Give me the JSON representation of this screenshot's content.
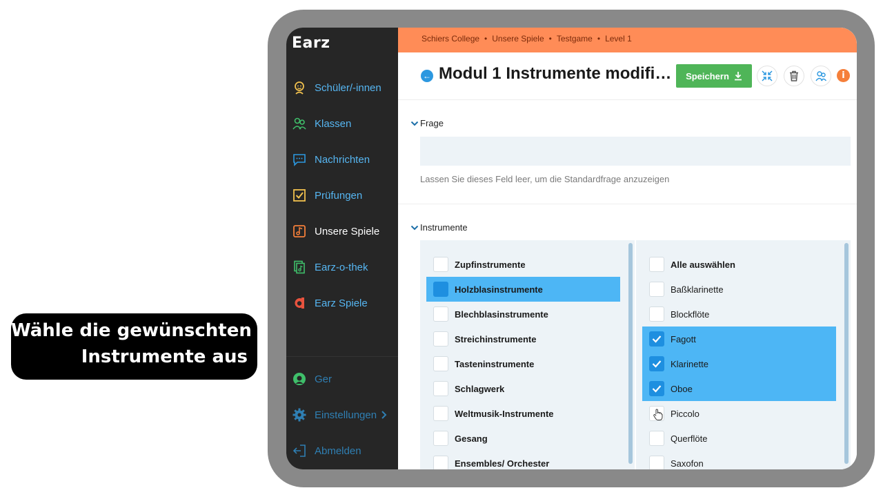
{
  "caption": {
    "line1": "Wähle die gewünschten",
    "line2": "Instrumente aus"
  },
  "app": {
    "logo": "Earz"
  },
  "sidebar": {
    "items": [
      {
        "label": "Schüler/-innen",
        "icon": "student-icon"
      },
      {
        "label": "Klassen",
        "icon": "classes-icon"
      },
      {
        "label": "Nachrichten",
        "icon": "messages-icon"
      },
      {
        "label": "Prüfungen",
        "icon": "exams-icon"
      },
      {
        "label": "Unsere Spiele",
        "icon": "games-icon",
        "active": true
      },
      {
        "label": "Earz-o-thek",
        "icon": "library-icon"
      },
      {
        "label": "Earz Spiele",
        "icon": "earz-games-icon"
      }
    ],
    "bottom": [
      {
        "label": "Ger",
        "icon": "language-icon"
      },
      {
        "label": "Einstellungen",
        "icon": "gear-icon"
      },
      {
        "label": "Abmelden",
        "icon": "logout-icon"
      }
    ]
  },
  "breadcrumb": [
    "Schiers College",
    "Unsere Spiele",
    "Testgame",
    "Level 1"
  ],
  "header": {
    "title": "Modul 1 Instrumente modifiziert",
    "save_label": "Speichern"
  },
  "frage": {
    "label": "Frage",
    "value": "",
    "hint": "Lassen Sie dieses Feld leer, um die Standardfrage anzuzeigen"
  },
  "instrumente": {
    "label": "Instrumente",
    "categories": [
      {
        "label": "Zupfinstrumente",
        "selected": false
      },
      {
        "label": "Holzblasinstrumente",
        "selected": true
      },
      {
        "label": "Blechblasinstrumente",
        "selected": false
      },
      {
        "label": "Streichinstrumente",
        "selected": false
      },
      {
        "label": "Tasteninstrumente",
        "selected": false
      },
      {
        "label": "Schlagwerk",
        "selected": false
      },
      {
        "label": "Weltmusik-Instrumente",
        "selected": false
      },
      {
        "label": "Gesang",
        "selected": false
      },
      {
        "label": "Ensembles/ Orchester",
        "selected": false
      }
    ],
    "select_all": "Alle auswählen",
    "instruments": [
      {
        "label": "Baßklarinette",
        "checked": false
      },
      {
        "label": "Blockflöte",
        "checked": false
      },
      {
        "label": "Fagott",
        "checked": true
      },
      {
        "label": "Klarinette",
        "checked": true
      },
      {
        "label": "Oboe",
        "checked": true
      },
      {
        "label": "Piccolo",
        "checked": false
      },
      {
        "label": "Querflöte",
        "checked": false
      },
      {
        "label": "Saxofon",
        "checked": false
      }
    ]
  },
  "colors": {
    "accent": "#4db6f5",
    "topbar": "#ff8c57",
    "save": "#4fb558",
    "sidebar": "#262626"
  }
}
